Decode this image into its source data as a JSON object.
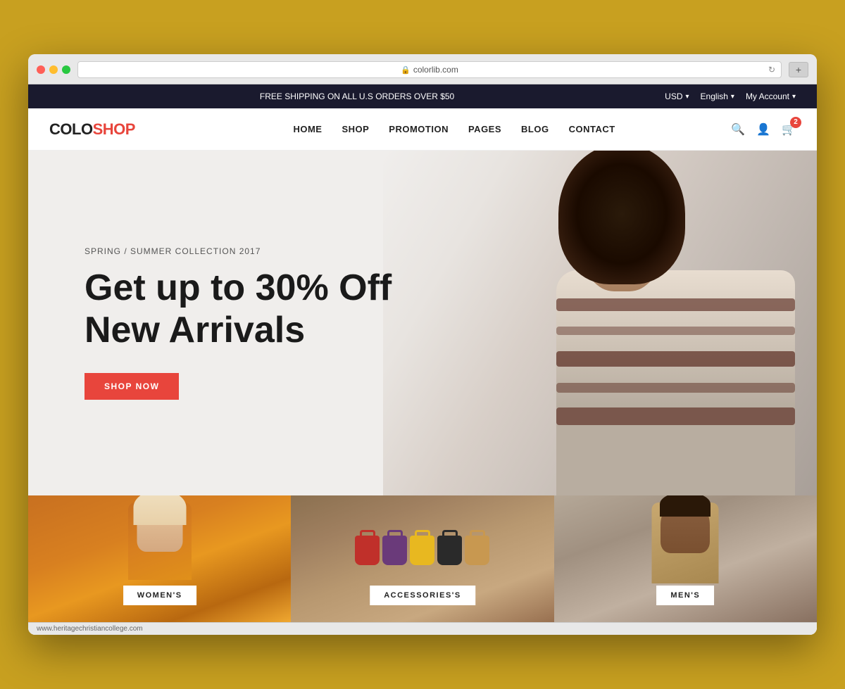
{
  "browser": {
    "url": "colorlib.com",
    "plus_label": "+",
    "status_bar": "www.heritagechristiancollege.com"
  },
  "top_banner": {
    "promo_text": "FREE SHIPPING ON ALL U.S ORDERS OVER $50",
    "currency": "USD",
    "language": "English",
    "account": "My Account"
  },
  "nav": {
    "logo_colo": "COLO",
    "logo_shop": "SHOP",
    "links": [
      {
        "label": "HOME"
      },
      {
        "label": "SHOP"
      },
      {
        "label": "PROMOTION"
      },
      {
        "label": "PAGES"
      },
      {
        "label": "BLOG"
      },
      {
        "label": "CONTACT"
      }
    ],
    "cart_count": "2"
  },
  "hero": {
    "subtitle": "SPRING / SUMMER COLLECTION 2017",
    "title_line1": "Get up to 30% Off",
    "title_line2": "New Arrivals",
    "cta_label": "SHOP NOW"
  },
  "categories": [
    {
      "label": "WOMEN'S",
      "id": "womens"
    },
    {
      "label": "ACCESSORIES'S",
      "id": "accessories"
    },
    {
      "label": "MEN'S",
      "id": "mens"
    }
  ],
  "bags": [
    {
      "color": "red"
    },
    {
      "color": "purple"
    },
    {
      "color": "yellow"
    },
    {
      "color": "dark"
    },
    {
      "color": "tan"
    }
  ]
}
